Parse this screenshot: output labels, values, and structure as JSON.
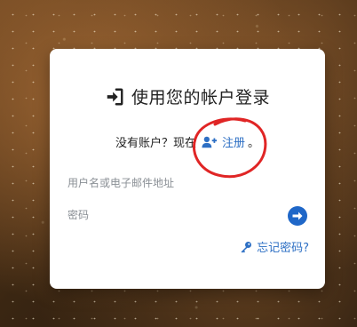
{
  "login": {
    "title": "使用您的帐户登录",
    "signup_prompt": "没有账户？现在",
    "signup_link": "注册",
    "signup_suffix": "。",
    "username_placeholder": "用户名或电子邮件地址",
    "password_placeholder": "密码",
    "forgot_link": "忘记密码?"
  },
  "colors": {
    "accent": "#2d6fc4",
    "button": "#1f67c8",
    "annotation": "#e02525"
  },
  "icons": {
    "title": "sign-in-icon",
    "signup": "user-plus-icon",
    "submit": "arrow-right-icon",
    "forgot": "key-icon"
  }
}
